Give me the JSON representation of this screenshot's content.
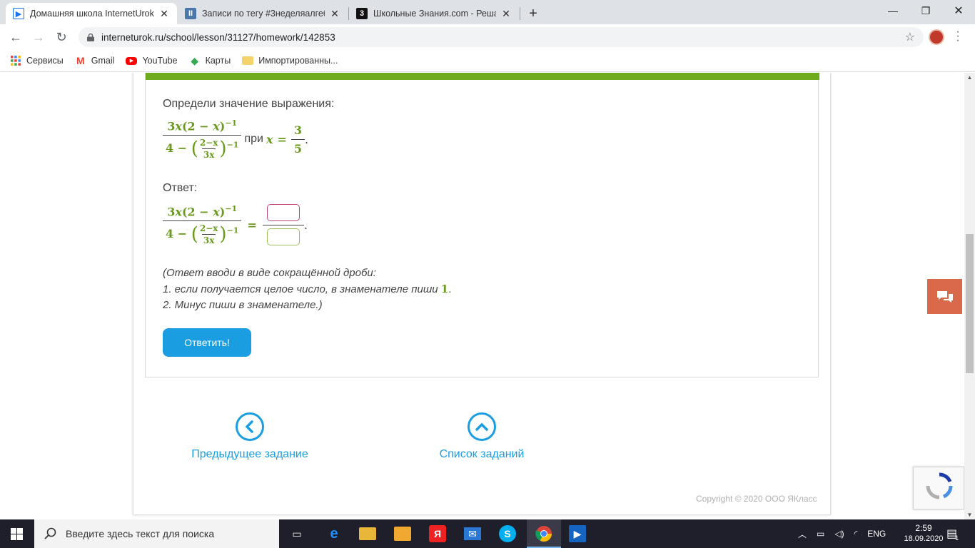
{
  "browser": {
    "tabs": [
      {
        "title": "Домашняя школа InternetUrok.r",
        "icon": "play-favicon",
        "active": true
      },
      {
        "title": "Записи по тегу #3неделяалгебр",
        "icon": "pause-favicon",
        "active": false
      },
      {
        "title": "Школьные Знания.com - Решае",
        "icon": "znanija-favicon",
        "active": false
      }
    ],
    "new_tab": "+",
    "url": "interneturok.ru/school/lesson/31127/homework/142853",
    "bookmarks": [
      {
        "label": "Сервисы",
        "icon": "apps-grid-icon"
      },
      {
        "label": "Gmail",
        "icon": "gmail-icon"
      },
      {
        "label": "YouTube",
        "icon": "youtube-icon"
      },
      {
        "label": "Карты",
        "icon": "maps-icon"
      },
      {
        "label": "Импортированны...",
        "icon": "folder-icon"
      }
    ]
  },
  "task": {
    "prompt": "Определи значение выражения:",
    "expr": {
      "num_a": "3",
      "num_x": "x",
      "num_paren": "(2 − ",
      "num_x2": "x",
      "num_close": ")",
      "num_exp": "−1",
      "den_four": "4 − ",
      "den_inner_num": "2−x",
      "den_inner_den": "3x",
      "den_exp": "−1"
    },
    "at_word": "при",
    "x_var": "x",
    "eq": "=",
    "x_num": "3",
    "x_den": "5",
    "period": ".",
    "answer_label": "Ответ:",
    "hint_lines": [
      "(Ответ вводи в виде сокращённой дроби:",
      "1. если получается целое число, в знаменателе пиши ",
      "2. Минус пиши в знаменателе.)"
    ],
    "hint_one": "1",
    "hint_one_tail": ".",
    "answer_numerator": "",
    "answer_denominator": "",
    "submit_label": "Ответить!"
  },
  "nav": {
    "prev_label": "Предыдущее задание",
    "list_label": "Список заданий"
  },
  "footer": {
    "copyright": "Copyright © 2020 ООО ЯКласс"
  },
  "taskbar": {
    "search_placeholder": "Введите здесь текст для поиска",
    "lang": "ENG",
    "time": "2:59",
    "date": "18.09.2020",
    "notifications": "1"
  },
  "colors": {
    "accent_green": "#6fab1d",
    "math_green": "#6a9a1c",
    "button_blue": "#1a9ee1",
    "chat_orange": "#d9694b"
  }
}
